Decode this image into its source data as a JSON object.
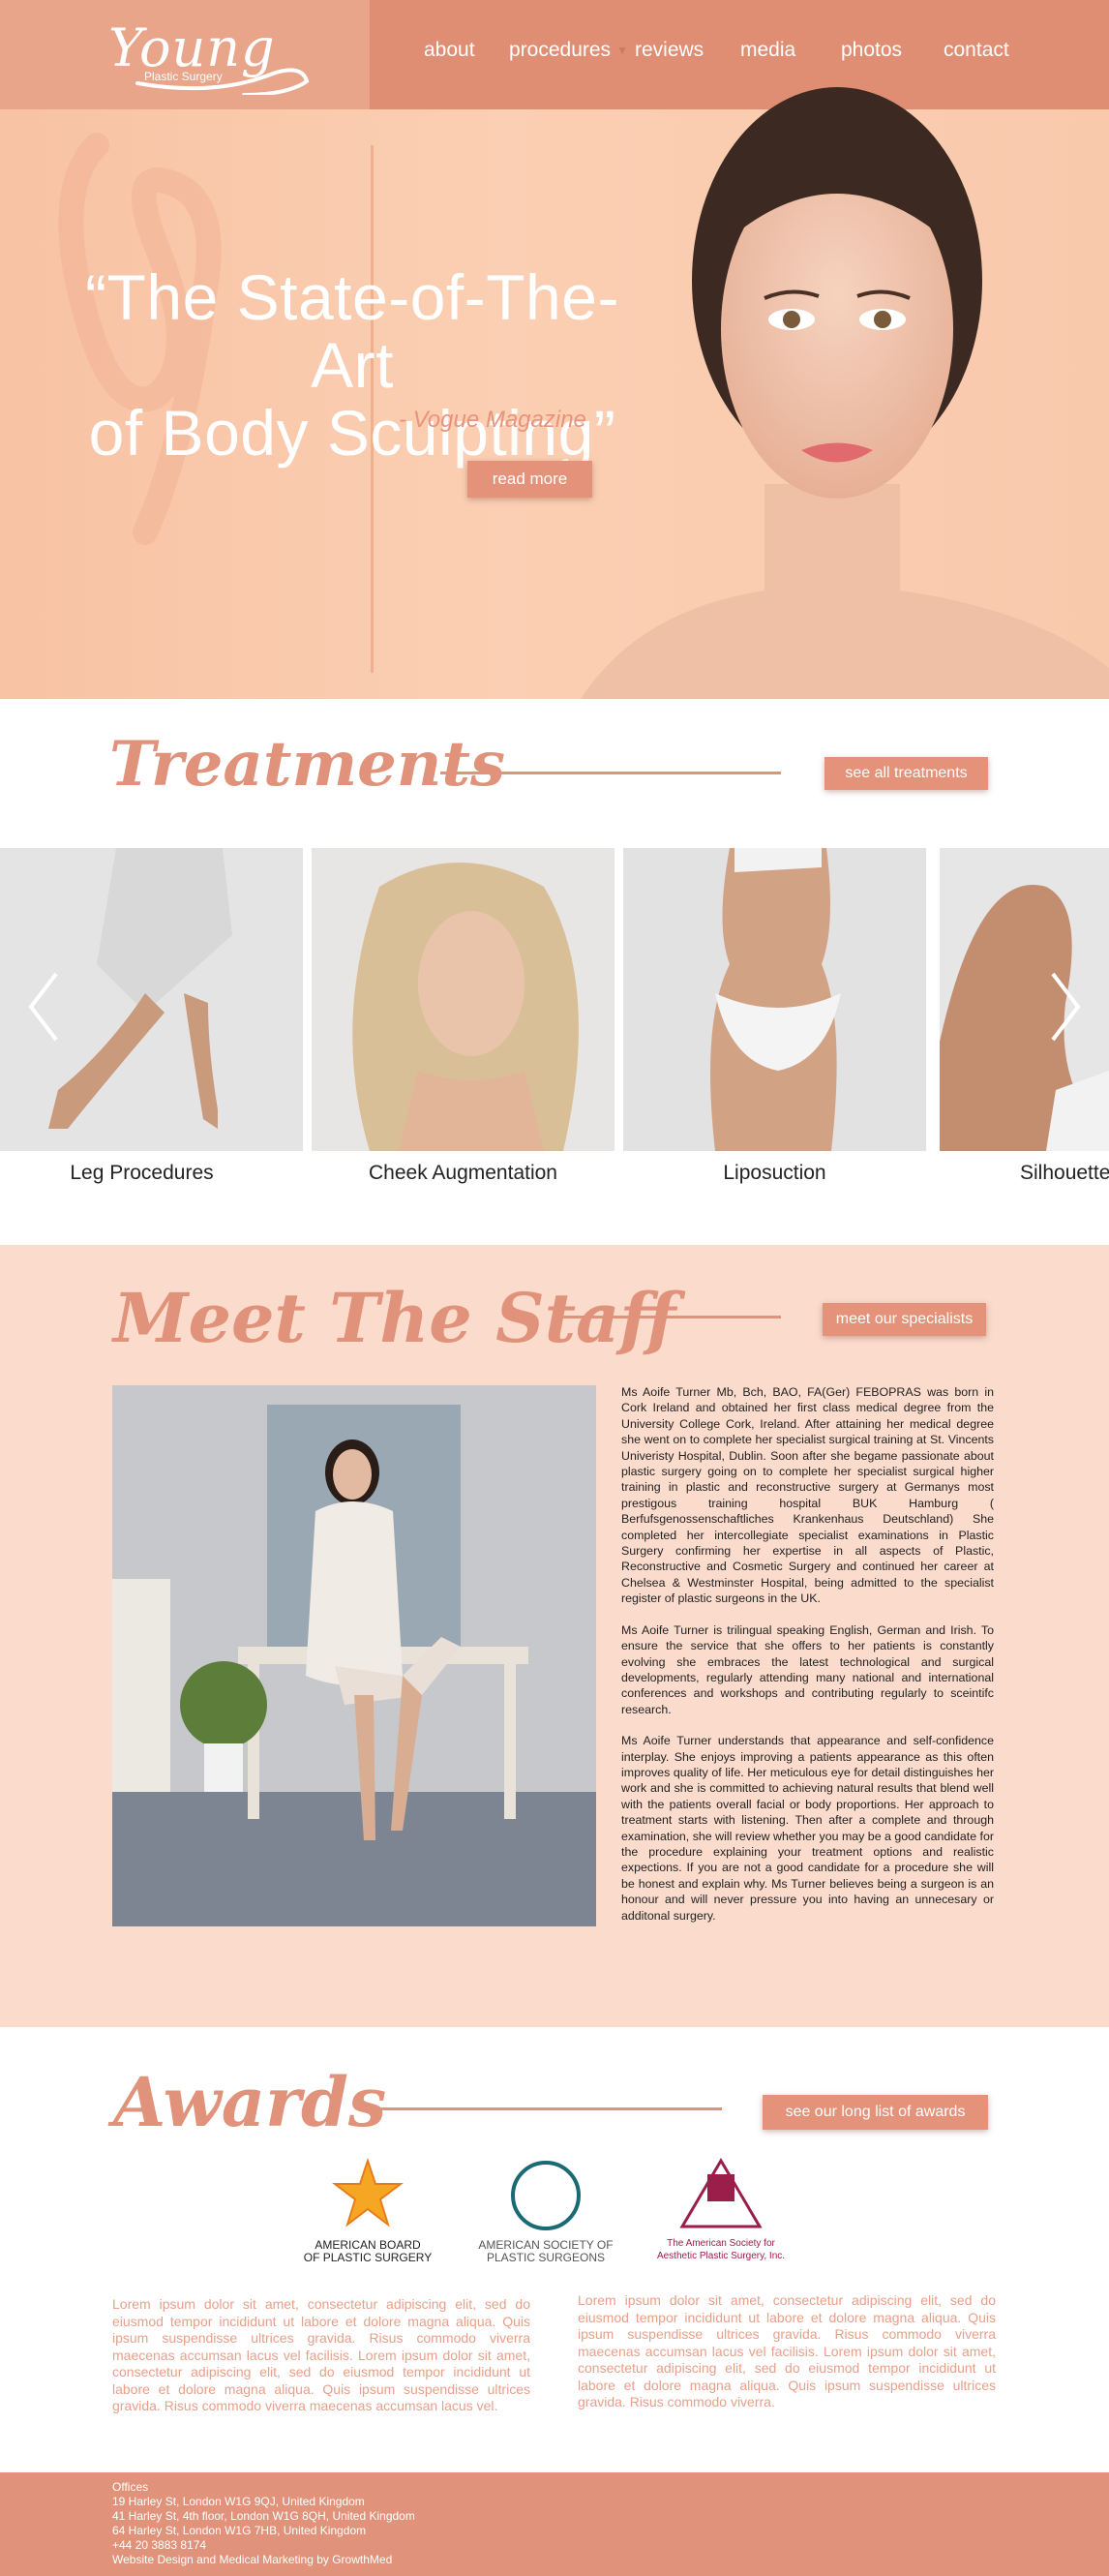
{
  "brand": {
    "logo_text": "Young",
    "logo_sub": "Plastic Surgery"
  },
  "nav": {
    "items": [
      {
        "label": "about"
      },
      {
        "label": "procedures"
      },
      {
        "label": "reviews"
      },
      {
        "label": "media"
      },
      {
        "label": "photos"
      },
      {
        "label": "contact"
      }
    ]
  },
  "hero": {
    "quote_line1": "“The State-of-The-Art",
    "quote_line2": "of Body Sculpting”",
    "source": "- Vogue Magazine",
    "button": "read more"
  },
  "treatments": {
    "title": "Treatments",
    "button": "see all treatments",
    "cards": [
      {
        "label": "Leg Procedures"
      },
      {
        "label": "Cheek Augmentation"
      },
      {
        "label": "Liposuction"
      },
      {
        "label": "Silhouette"
      }
    ]
  },
  "staff": {
    "title": "Meet The Staff",
    "button": "meet our specialists",
    "bio": [
      "Ms Aoife Turner Mb, Bch, BAO, FA(Ger) FEBOPRAS was born in Cork Ireland and obtained her first class medical degree from the University College Cork, Ireland. After attaining her medical degree she went on to complete her specialist surgical training at St. Vincents Univeristy Hospital, Dublin. Soon after she begame passionate about plastic surgery going on to complete her specialist surgical higher training in plastic and reconstructive surgery at Germanys most prestigous training hospital BUK Hamburg ( Berfufsgenossenschaftliches Krankenhaus Deutschland) She completed her intercollegiate specialist examinations in Plastic Surgery confirming her expertise in all aspects of Plastic, Reconstructive and Cosmetic Surgery and continued her career at Chelsea & Westminster Hospital, being admitted to the specialist register of plastic surgeons in the UK.",
      "Ms Aoife Turner is trilingual speaking English, German and Irish. To ensure the service that she offers to her patients is constantly evolving she embraces the latest technological and surgical developments, regularly attending many national and international conferences and workshops and contributing regularly to sceintifc research.",
      "Ms Aoife Turner understands that appearance and self-confidence interplay. She enjoys improving a patients appearance as this often improves quality of life. Her meticulous eye for detail distinguishes her work and she is committed to achieving natural results that blend well with the patients overall facial or body proportions. Her approach to treatment starts with listening. Then after a complete and through examination, she will review whether you may be a good candidate for the procedure explaining your treatment options and realistic expections. If you are not a good candidate for a procedure she will be honest and explain why. Ms Turner believes being a surgeon is an honour and will never pressure you into having an unnecesary or additonal surgery."
    ]
  },
  "awards": {
    "title": "Awards",
    "button": "see our long list of awards",
    "badges": [
      {
        "line1": "AMERICAN BOARD",
        "line2": "OF PLASTIC SURGERY"
      },
      {
        "line1": "AMERICAN SOCIETY OF",
        "line2": "PLASTIC SURGEONS"
      },
      {
        "line1": "The American Society for",
        "line2": "Aesthetic Plastic Surgery, Inc."
      }
    ],
    "text_left": "Lorem ipsum dolor sit amet, consectetur adipiscing elit, sed do eiusmod tempor incididunt ut labore et dolore magna aliqua. Quis ipsum suspendisse ultrices gravida. Risus commodo viverra maecenas accumsan lacus vel facilisis. Lorem ipsum dolor sit amet, consectetur adipiscing elit, sed do eiusmod tempor incididunt ut labore et dolore magna aliqua. Quis ipsum suspendisse ultrices gravida. Risus commodo viverra maecenas accumsan lacus vel.",
    "text_right": "Lorem ipsum dolor sit amet, consectetur adipiscing elit, sed do eiusmod tempor incididunt ut labore et dolore magna aliqua. Quis ipsum suspendisse ultrices gravida. Risus commodo viverra maecenas accumsan lacus vel facilisis. Lorem ipsum dolor sit amet, consectetur adipiscing elit, sed do eiusmod tempor incididunt ut labore et dolore magna aliqua. Quis ipsum suspendisse ultrices gravida. Risus commodo viverra."
  },
  "footer": {
    "lines": [
      "Offices",
      "19 Harley St, London W1G 9QJ, United Kingdom",
      "41 Harley St, 4th floor, London W1G 8QH, United Kingdom",
      "64 Harley St, London W1G 7HB, United Kingdom",
      "+44 20 3883 8174",
      "Website Design and Medical Marketing by GrowthMed"
    ]
  },
  "colors": {
    "accent": "#e0927a",
    "nav_bar": "#df8e73",
    "hero_bg": "#fbcfb3",
    "staff_bg": "#fadbcc",
    "footer_bg": "#e0937a"
  }
}
